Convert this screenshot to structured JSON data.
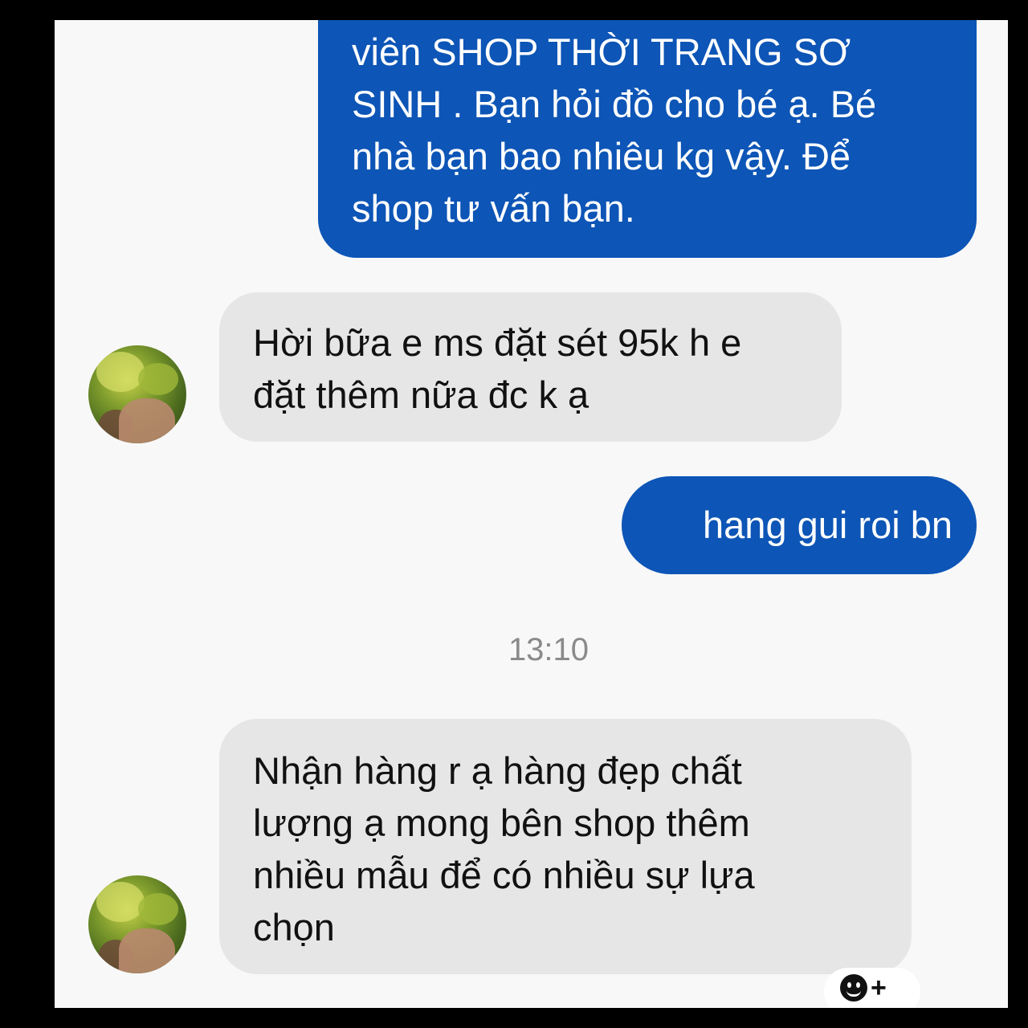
{
  "messages": {
    "out_1": "viên SHOP THỜI TRANG SƠ\nSINH . Bạn hỏi đồ cho bé ạ. Bé\nnhà bạn bao nhiêu kg vậy. Để\nshop tư vấn bạn.",
    "in_1": "Hời bữa e ms đặt sét 95k h e\nđặt thêm nữa đc k ạ",
    "out_2": "hang gui roi bn",
    "timestamp": "13:10",
    "in_2": "Nhận hàng r ạ hàng đẹp chất\nlượng ạ mong bên shop thêm\nnhiều mẫu để có nhiều sự lựa\nchọn"
  },
  "icons": {
    "avatar": "profile-photo",
    "reaction": "add-reaction-icon"
  },
  "colors": {
    "outgoing_bubble": "#0d55b6",
    "incoming_bubble": "#e6e6e6",
    "background": "#f8f8f8",
    "timestamp": "#8a8a8a"
  },
  "reaction_symbol": "+"
}
